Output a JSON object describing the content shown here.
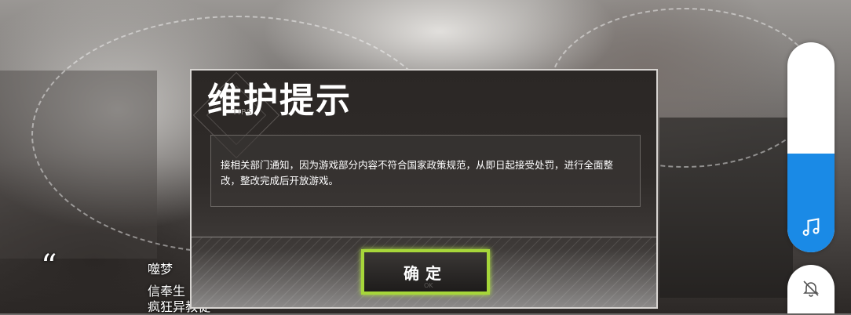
{
  "background": {
    "quote_mark": "“",
    "name_fragment": "噬梦",
    "line1": "信奉生",
    "line2": "疯狂异教徒"
  },
  "dialog": {
    "title": "维护提示",
    "subtitle": "TIPS",
    "message": "接相关部门通知，因为游戏部分内容不符合国家政策规范，从即日起接受处罚，进行全面整改，整改完成后开放游戏。",
    "confirm_label": "确定",
    "confirm_sub": "OK"
  },
  "volume": {
    "level_percent": 47,
    "icon": "music-note-icon",
    "accent_color": "#1a8ae6"
  },
  "mute": {
    "icon": "bell-off-icon"
  }
}
